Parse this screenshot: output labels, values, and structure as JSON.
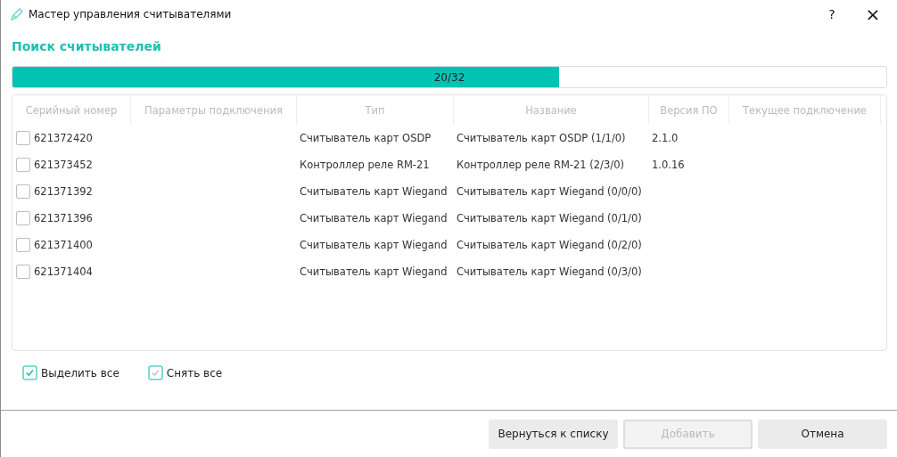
{
  "window": {
    "title": "Мастер управления считывателями",
    "help": "?",
    "close": "×"
  },
  "heading": "Поиск считывателей",
  "progress": {
    "level": 0.625,
    "label": "20/32"
  },
  "table": {
    "columns": [
      "Серийный номер",
      "Параметры подключения",
      "Тип",
      "Название",
      "Версия ПО",
      "Текущее подключение"
    ],
    "rows": [
      {
        "checked": false,
        "cells": [
          "621372420",
          "",
          "Считыватель карт OSDP",
          "Считыватель карт OSDP (1/1/0)",
          "2.1.0",
          ""
        ]
      },
      {
        "checked": false,
        "cells": [
          "621373452",
          "",
          "Контроллер реле RM-21",
          "Контроллер реле RM-21 (2/3/0)",
          "1.0.16",
          ""
        ]
      },
      {
        "checked": false,
        "cells": [
          "621371392",
          "",
          "Считыватель карт Wiegand",
          "Считыватель карт Wiegand (0/0/0)",
          "",
          ""
        ]
      },
      {
        "checked": false,
        "cells": [
          "621371396",
          "",
          "Считыватель карт Wiegand",
          "Считыватель карт Wiegand (0/1/0)",
          "",
          ""
        ]
      },
      {
        "checked": false,
        "cells": [
          "621371400",
          "",
          "Считыватель карт Wiegand",
          "Считыватель карт Wiegand (0/2/0)",
          "",
          ""
        ]
      },
      {
        "checked": false,
        "cells": [
          "621371404",
          "",
          "Считыватель карт Wiegand",
          "Считыватель карт Wiegand (0/3/0)",
          "",
          ""
        ]
      }
    ]
  },
  "bulk_actions": [
    {
      "label": "Выделить все",
      "disabled": false
    },
    {
      "label": "Снять все",
      "disabled": true
    }
  ],
  "buttons": [
    {
      "label": "Вернуться к списку",
      "disabled": false
    },
    {
      "label": "Добавить",
      "disabled": true
    },
    {
      "label": "Отмена",
      "disabled": false
    }
  ]
}
